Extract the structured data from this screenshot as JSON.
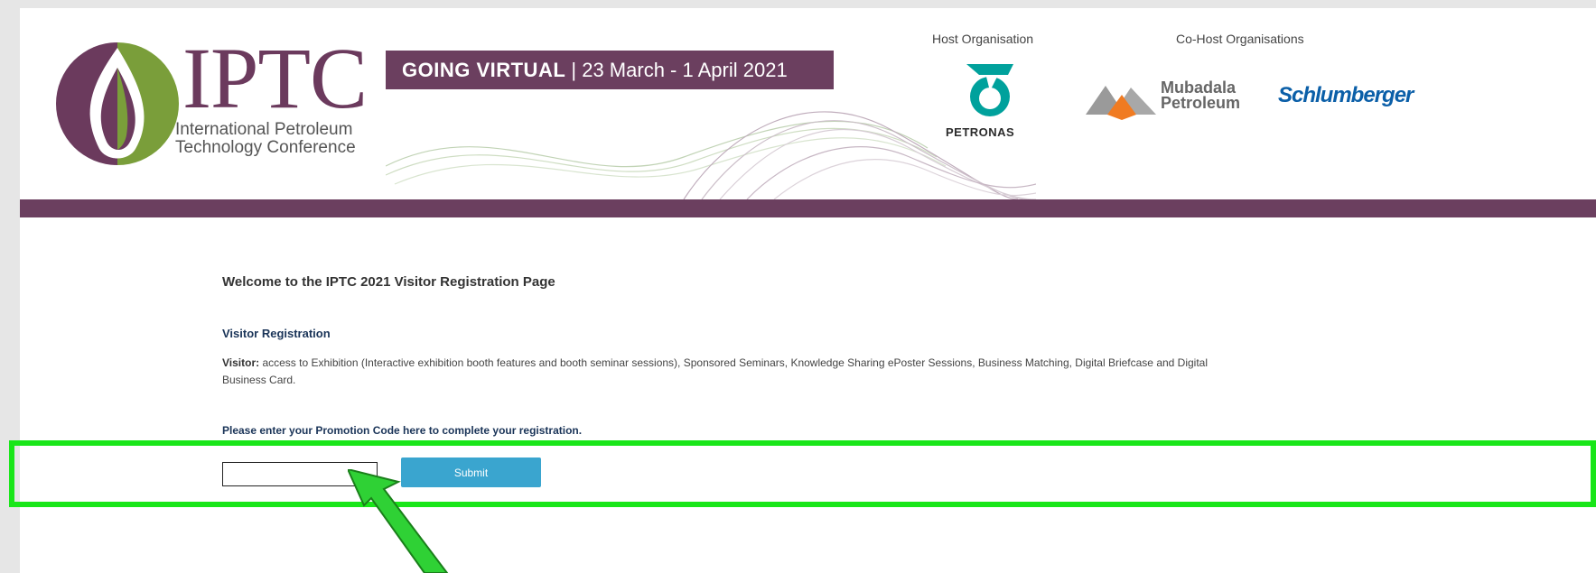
{
  "header": {
    "logo_word": "IPTC",
    "logo_subtitle_line1": "International Petroleum",
    "logo_subtitle_line2": "Technology Conference",
    "banner_strong": "GOING VIRTUAL",
    "banner_date": " | 23 March - 1 April 2021",
    "host_label": "Host Organisation",
    "cohost_label": "Co-Host Organisations",
    "host_name": "PETRONAS",
    "cohost_1_line1": "Mubadala",
    "cohost_1_line2": "Petroleum",
    "cohost_2": "Schlumberger"
  },
  "content": {
    "welcome_title": "Welcome to the IPTC 2021 Visitor Registration Page",
    "section_title": "Visitor Registration",
    "visitor_label": "Visitor:",
    "visitor_description": " access to Exhibition (Interactive exhibition booth features and booth seminar sessions), Sponsored Seminars, Knowledge Sharing ePoster Sessions, Business Matching, Digital Briefcase and Digital Business Card.",
    "promo_prompt": "Please enter your Promotion Code here to complete your registration.",
    "promo_input_value": "",
    "submit_label": "Submit"
  },
  "colors": {
    "brand_purple": "#6b3f5f",
    "brand_green": "#7a9e3a",
    "submit_blue": "#3aa5cf",
    "highlight_green": "#19e619"
  }
}
